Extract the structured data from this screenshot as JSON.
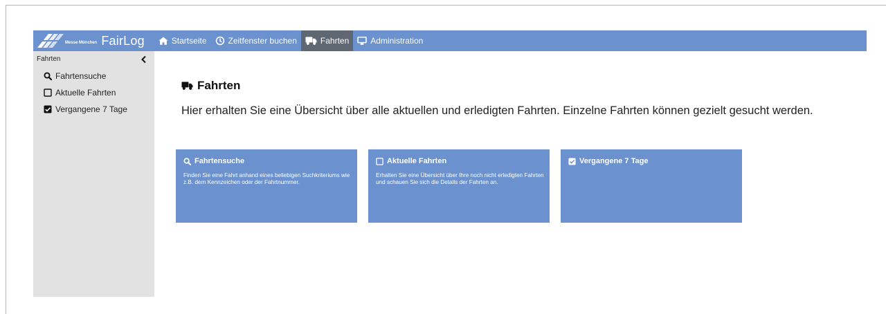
{
  "brand": {
    "small_text": "Messe München",
    "name": "FairLog"
  },
  "nav": {
    "items": [
      {
        "label": "Startseite",
        "icon": "home-icon",
        "active": false
      },
      {
        "label": "Zeitfenster buchen",
        "icon": "clock-icon",
        "active": false
      },
      {
        "label": "Fahrten",
        "icon": "truck-icon",
        "active": true
      },
      {
        "label": "Administration",
        "icon": "monitor-icon",
        "active": false
      }
    ]
  },
  "sidebar": {
    "title": "Fahrten",
    "items": [
      {
        "label": "Fahrtensuche",
        "icon": "search-icon"
      },
      {
        "label": "Aktuelle Fahrten",
        "icon": "square-outline-icon"
      },
      {
        "label": "Vergangene 7 Tage",
        "icon": "checkbox-checked-icon"
      }
    ]
  },
  "main": {
    "heading": "Fahrten",
    "description": "Hier erhalten Sie eine Übersicht über alle aktuellen und erledigten Fahrten. Einzelne Fahrten können gezielt gesucht werden.",
    "cards": [
      {
        "title": "Fahrtensuche",
        "icon": "search-icon",
        "text": "Finden Sie eine Fahrt anhand eines beliebigen Suchkriteriums wie z.B. dem Kennzeichen oder der Fahrtnummer."
      },
      {
        "title": "Aktuelle Fahrten",
        "icon": "square-outline-icon",
        "text": "Erhalten Sie eine Übersicht über Ihre noch nicht erledigten Fahrten und schauen Sie sich die Details der Fahrten an."
      },
      {
        "title": "Vergangene 7 Tage",
        "icon": "checkbox-checked-icon",
        "text": ""
      }
    ]
  },
  "colors": {
    "accent": "#6b92cf",
    "nav_active": "#5f6872",
    "sidebar_bg": "#e2e2e2"
  }
}
